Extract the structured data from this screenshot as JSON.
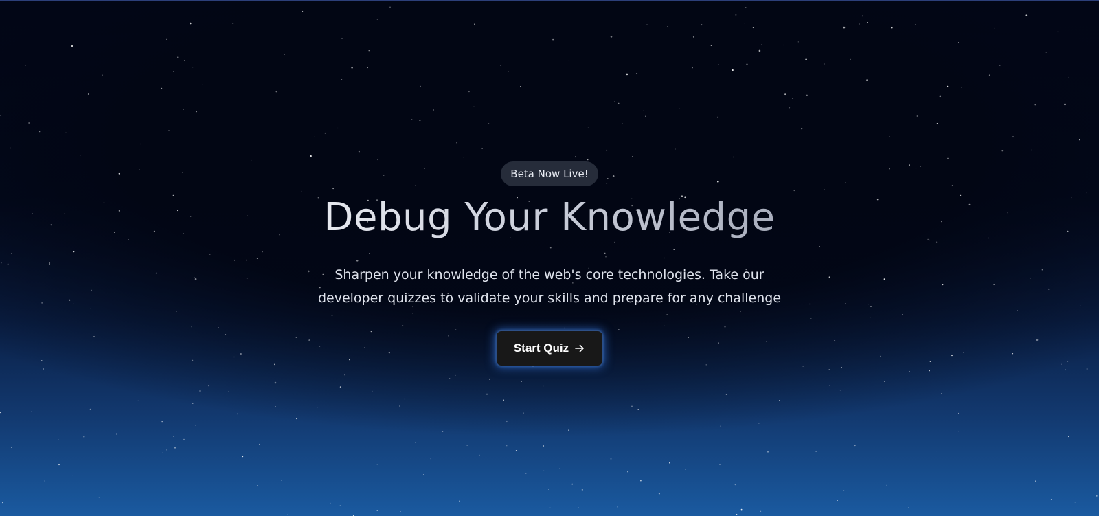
{
  "hero": {
    "badge": "Beta Now Live!",
    "title": "Debug Your Knowledge",
    "subtitle": "Sharpen your knowledge of the web's core technologies. Take our developer quizzes to validate your skills and prepare for any challenge",
    "cta_label": "Start Quiz",
    "cta_icon": "arrow-right-icon"
  },
  "colors": {
    "background_top": "#020617",
    "background_bottom": "#1a5aa0",
    "button_bg": "#181818",
    "button_glow": "#408aff",
    "badge_bg": "#262c3a"
  }
}
